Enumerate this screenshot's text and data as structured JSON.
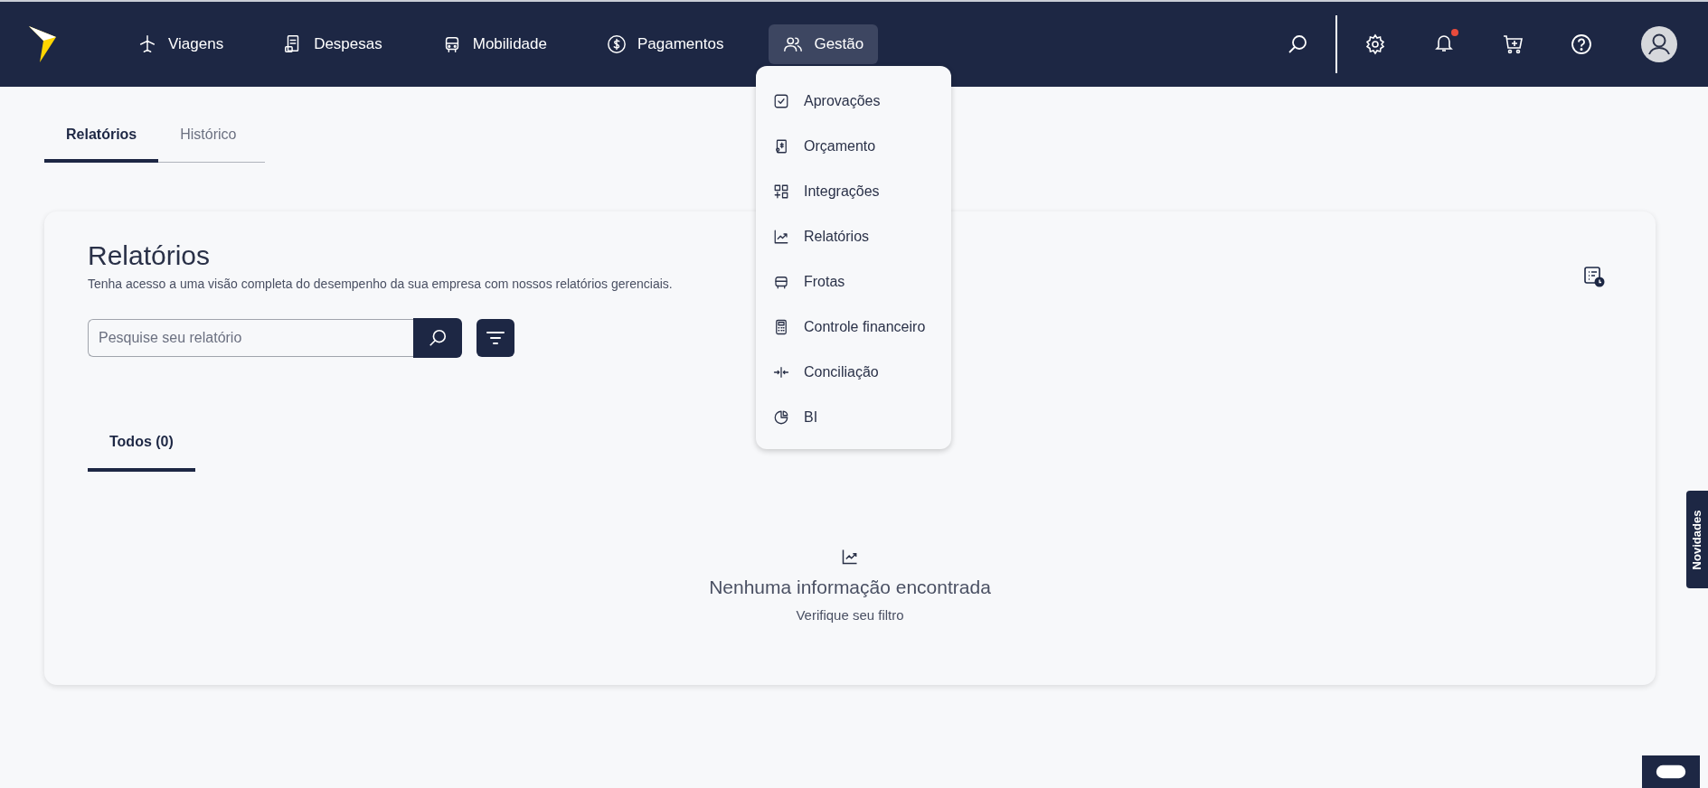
{
  "nav": [
    {
      "label": "Viagens",
      "selected": false
    },
    {
      "label": "Despesas",
      "selected": false
    },
    {
      "label": "Mobilidade",
      "selected": false
    },
    {
      "label": "Pagamentos",
      "selected": false
    },
    {
      "label": "Gestão",
      "selected": true
    }
  ],
  "notifications": {
    "unread": true
  },
  "menu": [
    {
      "label": "Aprovações"
    },
    {
      "label": "Orçamento"
    },
    {
      "label": "Integrações"
    },
    {
      "label": "Relatórios"
    },
    {
      "label": "Frotas"
    },
    {
      "label": "Controle financeiro"
    },
    {
      "label": "Conciliação"
    },
    {
      "label": "BI"
    }
  ],
  "page_tabs": [
    {
      "label": "Relatórios",
      "selected": true
    },
    {
      "label": "Histórico",
      "selected": false
    }
  ],
  "card": {
    "title": "Relatórios",
    "description": "Tenha acesso a uma visão completa do desempenho da sua empresa com nossos relatórios gerenciais.",
    "search": {
      "placeholder": "Pesquise seu relatório"
    },
    "filter_tabs": [
      {
        "label": "Todos (0)",
        "selected": true
      }
    ],
    "empty": {
      "title": "Nenhuma informação encontrada",
      "subtitle": "Verifique seu filtro"
    }
  },
  "side_tab": "Novidades"
}
